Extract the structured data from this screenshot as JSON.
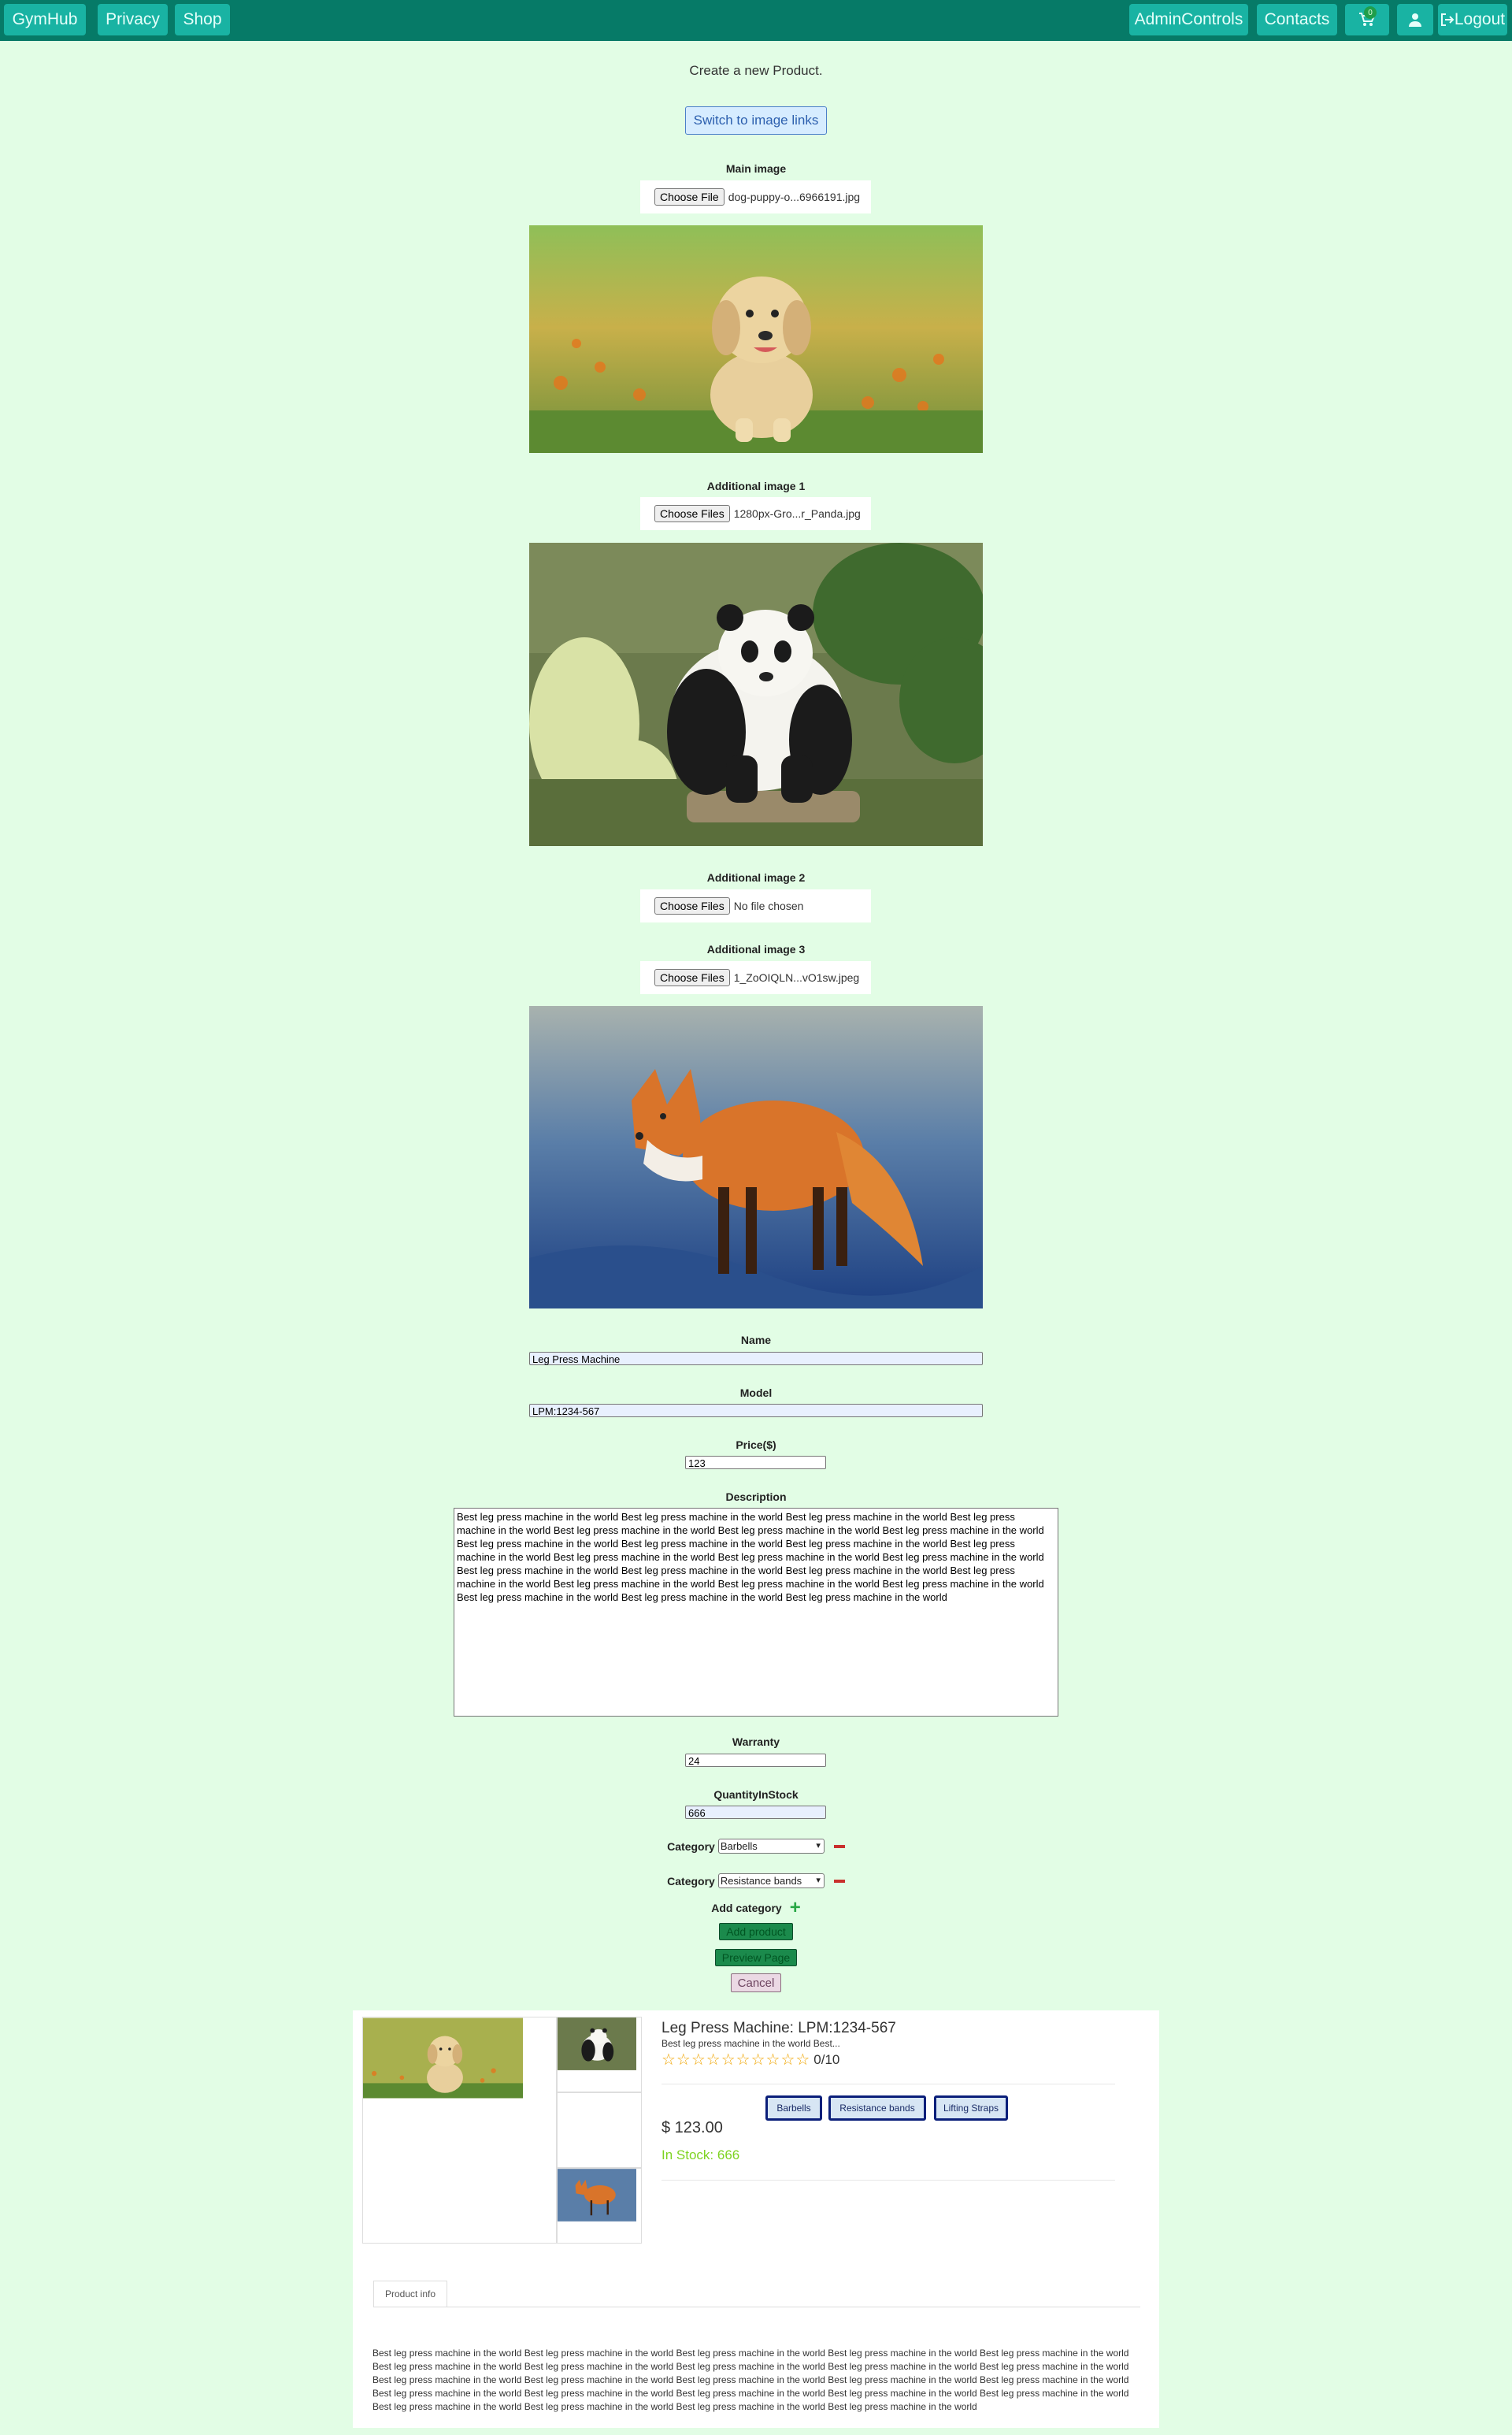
{
  "nav": {
    "brand": "GymHub",
    "privacy": "Privacy",
    "shop": "Shop",
    "admin": "AdminControls",
    "contacts": "Contacts",
    "cart_count": "0",
    "logout": "Logout"
  },
  "form": {
    "title": "Create a new Product.",
    "switch_label": "Switch to image links",
    "main_image_label": "Main image",
    "main_file_button": "Choose File",
    "main_file_name": "dog-puppy-o...6966191.jpg",
    "add1_label": "Additional image 1",
    "add1_button": "Choose Files",
    "add1_file": "1280px-Gro...r_Panda.jpg",
    "add2_label": "Additional image 2",
    "add2_button": "Choose Files",
    "add2_file": "No file chosen",
    "add3_label": "Additional image 3",
    "add3_button": "Choose Files",
    "add3_file": "1_ZoOIQLN...vO1sw.jpeg",
    "name_label": "Name",
    "name_value": "Leg Press Machine",
    "model_label": "Model",
    "model_value": "LPM:1234-567",
    "price_label": "Price($)",
    "price_value": "123",
    "description_label": "Description",
    "description_value": "Best leg press machine in the world Best leg press machine in the world Best leg press machine in the world Best leg press machine in the world Best leg press machine in the world Best leg press machine in the world Best leg press machine in the world Best leg press machine in the world Best leg press machine in the world Best leg press machine in the world Best leg press machine in the world Best leg press machine in the world Best leg press machine in the world Best leg press machine in the world Best leg press machine in the world Best leg press machine in the world Best leg press machine in the world Best leg press machine in the world Best leg press machine in the world Best leg press machine in the world Best leg press machine in the world Best leg press machine in the world Best leg press machine in the world Best leg press machine in the world",
    "warranty_label": "Warranty",
    "warranty_value": "24",
    "quantity_label": "QuantityInStock",
    "quantity_value": "666",
    "category_label": "Category",
    "category1": "Barbells",
    "category2": "Resistance bands",
    "add_category_label": "Add category",
    "add_product": "Add product",
    "preview_page": "Preview Page",
    "cancel": "Cancel"
  },
  "preview": {
    "title": "Leg Press Machine: LPM:1234-567",
    "short_desc": "Best leg press machine in the world Best...",
    "stars": "☆☆☆☆☆☆☆☆☆☆",
    "rating": "0/10",
    "categories": [
      "Barbells",
      "Resistance bands",
      "Lifting Straps"
    ],
    "price": "$ 123.00",
    "stock": "In Stock: 666",
    "tab_label": "Product info",
    "full_desc": "Best leg press machine in the world Best leg press machine in the world Best leg press machine in the world Best leg press machine in the world Best leg press machine in the world Best leg press machine in the world Best leg press machine in the world Best leg press machine in the world Best leg press machine in the world Best leg press machine in the world Best leg press machine in the world Best leg press machine in the world Best leg press machine in the world Best leg press machine in the world Best leg press machine in the world Best leg press machine in the world Best leg press machine in the world Best leg press machine in the world Best leg press machine in the world Best leg press machine in the world Best leg press machine in the world Best leg press machine in the world Best leg press machine in the world Best leg press machine in the world"
  },
  "colors": {
    "navbar": "#067a67",
    "nav_button": "#19b3a3",
    "page_bg": "#e2fde5",
    "stock": "#7ed321",
    "chip_border": "#0b1f7a"
  }
}
